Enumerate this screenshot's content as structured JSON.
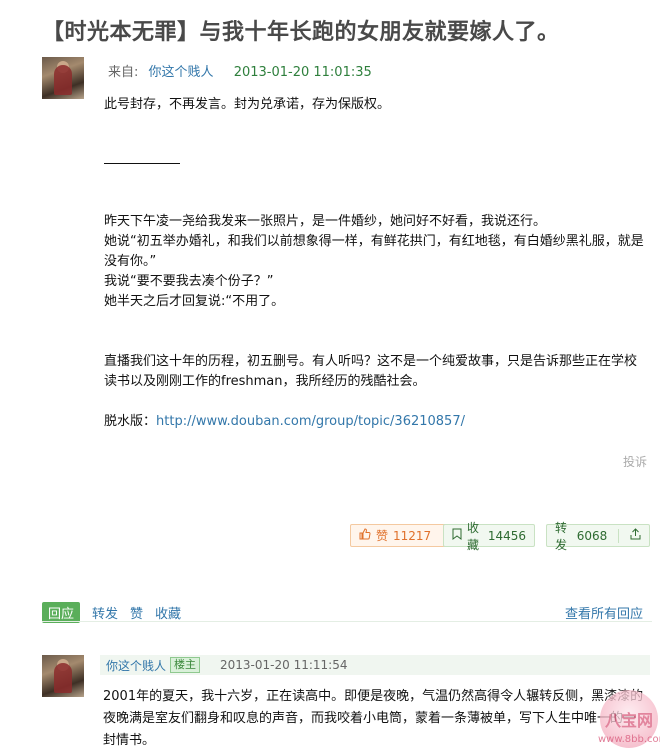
{
  "topic": {
    "title": "【时光本无罪】与我十年长跑的女朋友就要嫁人了。",
    "from_label": "来自:",
    "author": "你这个贱人",
    "time": "2013-01-20 11:01:35"
  },
  "post": {
    "paragraphs": [
      "此号封存，不再发言。封为兑承诺，存为保版权。",
      "昨天下午凌一尧给我发来一张照片，是一件婚纱，她问好不好看，我说还行。",
      "她说“初五举办婚礼，和我们以前想象得一样，有鲜花拱门，有红地毯，有白婚纱黑礼服，就是没有你。”",
      "我说“要不要我去凑个份子？”",
      "她半天之后才回复说:“不用了。",
      "直播我们这十年的历程，初五删号。有人听吗？这不是一个纯爱故事，只是告诉那些正在学校读书以及刚刚工作的freshman，我所经历的残酷社会。"
    ],
    "link_prefix": "脱水版：",
    "link": "http://www.douban.com/group/topic/36210857/"
  },
  "report_label": "投诉",
  "actions": {
    "like_label": "赞",
    "like_count": "11217",
    "collect_label": "收藏",
    "collect_count": "14456",
    "share_label": "转发",
    "share_count": "6068"
  },
  "tabs": {
    "reply": "回应",
    "share": "转发",
    "like": "赞",
    "collect": "收藏",
    "view_all": "查看所有回应"
  },
  "reply": {
    "author": "你这个贱人",
    "badge": "楼主",
    "time": "2013-01-20 11:11:54",
    "text": "2001年的夏天，我十六岁，正在读高中。即便是夜晚，气温仍然高得令人辗转反侧，黑漆漆的夜晚满是室友们翻身和叹息的声音，而我咬着小电筒，蒙着一条薄被单，写下人生中唯一的一封情书。"
  },
  "watermark": {
    "text": "八宝网",
    "site": "www.8bb.com"
  },
  "colors": {
    "link": "#3377aa",
    "time_green": "#2e7f3c",
    "like_orange": "#e0712b",
    "reply_tab_green": "#5aae5a"
  }
}
